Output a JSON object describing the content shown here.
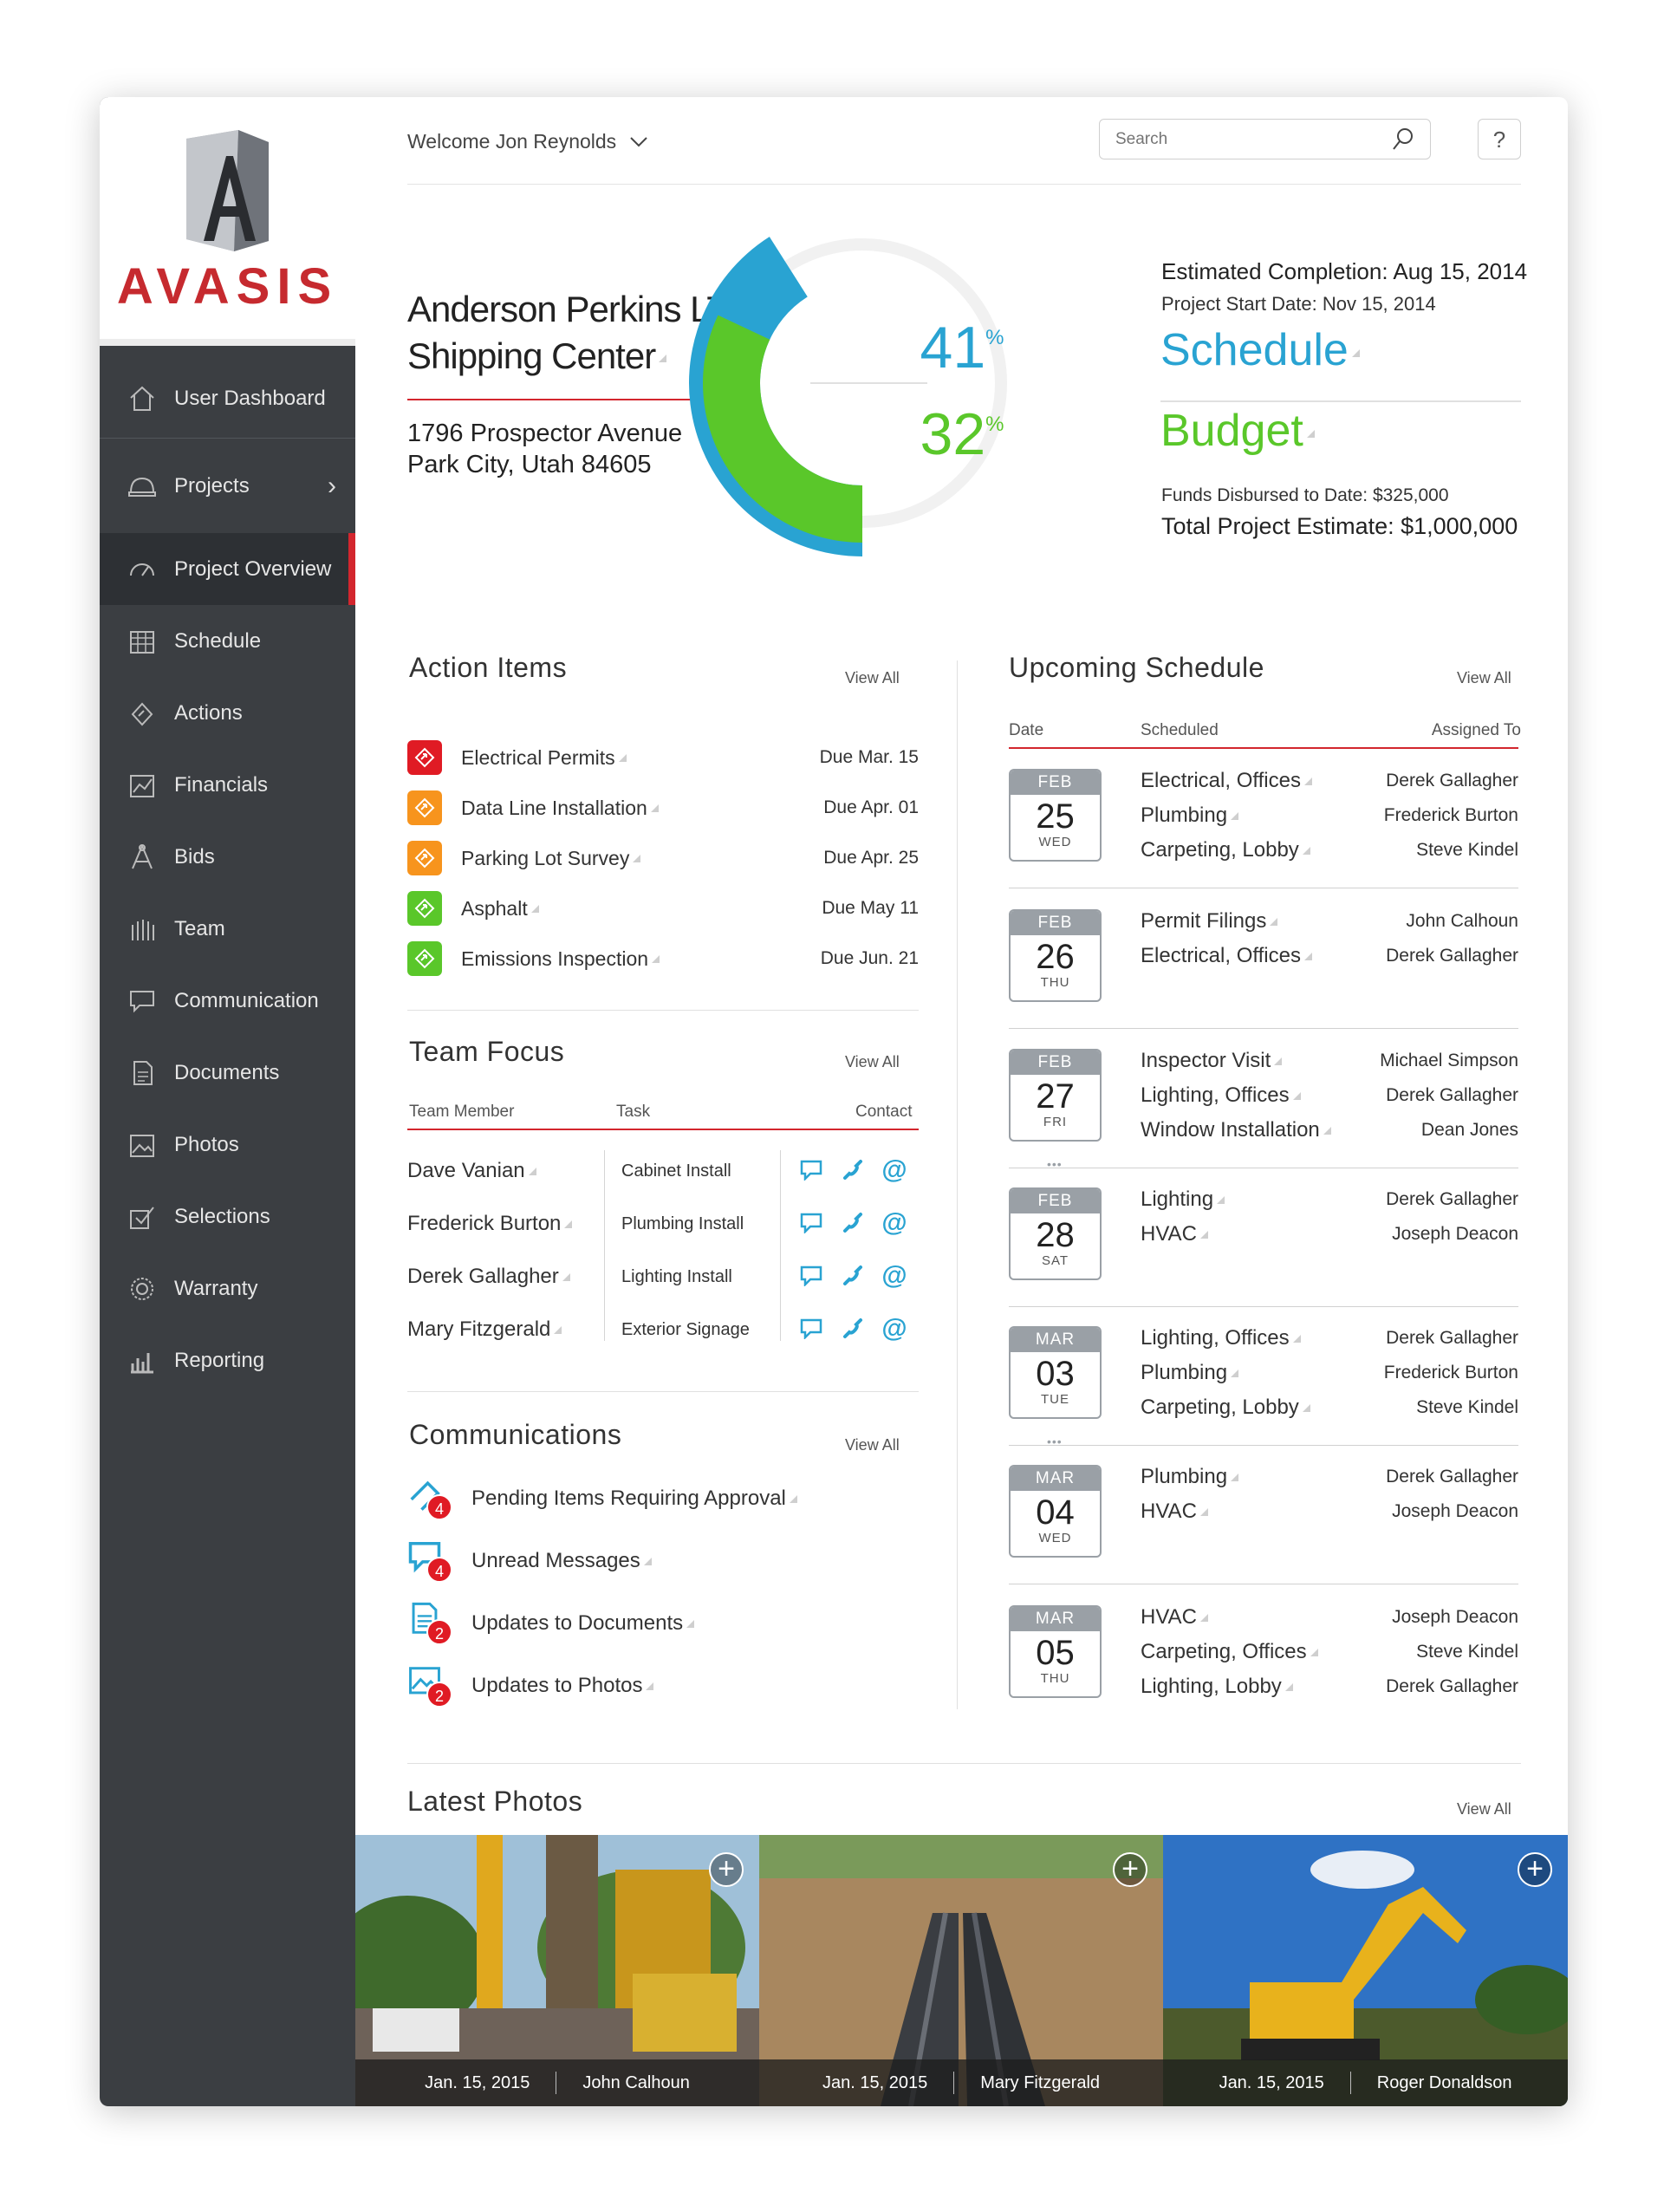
{
  "brand": {
    "name": "AVASIS",
    "tm": "™"
  },
  "header": {
    "welcome": "Welcome Jon Reynolds",
    "search_placeholder": "Search",
    "help": "?"
  },
  "sidebar": {
    "items": [
      {
        "label": "User Dashboard",
        "icon": "home-icon"
      },
      {
        "label": "Projects",
        "icon": "hard-hat-icon"
      },
      {
        "label": "Project Overview",
        "icon": "gauge-icon",
        "active": true
      },
      {
        "label": "Schedule",
        "icon": "calendar-icon"
      },
      {
        "label": "Actions",
        "icon": "action-icon"
      },
      {
        "label": "Financials",
        "icon": "chart-icon"
      },
      {
        "label": "Bids",
        "icon": "compass-icon"
      },
      {
        "label": "Team",
        "icon": "team-icon"
      },
      {
        "label": "Communication",
        "icon": "chat-icon"
      },
      {
        "label": "Documents",
        "icon": "document-icon"
      },
      {
        "label": "Photos",
        "icon": "photo-icon"
      },
      {
        "label": "Selections",
        "icon": "selection-icon"
      },
      {
        "label": "Warranty",
        "icon": "warranty-icon"
      },
      {
        "label": "Reporting",
        "icon": "bar-chart-icon"
      }
    ]
  },
  "project": {
    "name_line1": "Anderson Perkins LTD",
    "name_line2": "Shipping Center",
    "address_line1": "1796 Prospector Avenue",
    "address_line2": "Park City, Utah  84605",
    "schedule_pct": "41",
    "budget_pct": "32",
    "pct_sign": "%",
    "schedule_value": 0.41,
    "budget_value": 0.32,
    "schedule_color": "#29a3d2",
    "budget_color": "#5ac72a",
    "est_completion": "Estimated Completion: Aug 15, 2014",
    "start_date": "Project Start Date: Nov 15, 2014",
    "schedule_label": "Schedule",
    "budget_label": "Budget",
    "funds": "Funds Disbursed to Date: $325,000",
    "total": "Total Project Estimate: $1,000,000"
  },
  "action_items": {
    "title": "Action Items",
    "view_all": "View All",
    "items": [
      {
        "label": "Electrical Permits",
        "due": "Due Mar. 15",
        "color": "#e01b24"
      },
      {
        "label": "Data Line Installation",
        "due": "Due Apr. 01",
        "color": "#f7941d"
      },
      {
        "label": "Parking Lot Survey",
        "due": "Due Apr. 25",
        "color": "#f7941d"
      },
      {
        "label": "Asphalt",
        "due": "Due May 11",
        "color": "#5ac72a"
      },
      {
        "label": "Emissions Inspection",
        "due": "Due Jun. 21",
        "color": "#5ac72a"
      }
    ]
  },
  "team_focus": {
    "title": "Team Focus",
    "view_all": "View All",
    "col_member": "Team Member",
    "col_task": "Task",
    "col_contact": "Contact",
    "rows": [
      {
        "name": "Dave Vanian",
        "task": "Cabinet Install"
      },
      {
        "name": "Frederick Burton",
        "task": "Plumbing Install"
      },
      {
        "name": "Derek Gallagher",
        "task": "Lighting Install"
      },
      {
        "name": "Mary Fitzgerald",
        "task": "Exterior Signage"
      }
    ]
  },
  "communications": {
    "title": "Communications",
    "view_all": "View All",
    "items": [
      {
        "label": "Pending Items Requiring Approval",
        "count": "4",
        "icon": "approval-icon"
      },
      {
        "label": "Unread Messages",
        "count": "4",
        "icon": "message-icon"
      },
      {
        "label": "Updates to Documents",
        "count": "2",
        "icon": "document-icon"
      },
      {
        "label": "Updates to Photos",
        "count": "2",
        "icon": "photo-icon"
      }
    ]
  },
  "schedule": {
    "title": "Upcoming Schedule",
    "view_all": "View All",
    "col_date": "Date",
    "col_scheduled": "Scheduled",
    "col_assigned": "Assigned To",
    "days": [
      {
        "month": "FEB",
        "day": "25",
        "weekday": "WED",
        "tasks": [
          [
            "Electrical, Offices",
            "Derek Gallagher"
          ],
          [
            "Plumbing",
            "Frederick Burton"
          ],
          [
            "Carpeting, Lobby",
            "Steve Kindel"
          ]
        ]
      },
      {
        "month": "FEB",
        "day": "26",
        "weekday": "THU",
        "tasks": [
          [
            "Permit Filings",
            "John Calhoun"
          ],
          [
            "Electrical, Offices",
            "Derek Gallagher"
          ]
        ]
      },
      {
        "month": "FEB",
        "day": "27",
        "weekday": "FRI",
        "tasks": [
          [
            "Inspector Visit",
            "Michael Simpson"
          ],
          [
            "Lighting, Offices",
            "Derek Gallagher"
          ],
          [
            "Window Installation",
            "Dean Jones"
          ]
        ]
      },
      {
        "month": "FEB",
        "day": "28",
        "weekday": "SAT",
        "tasks": [
          [
            "Lighting",
            "Derek Gallagher"
          ],
          [
            "HVAC",
            "Joseph Deacon"
          ]
        ]
      },
      {
        "month": "MAR",
        "day": "03",
        "weekday": "TUE",
        "tasks": [
          [
            "Lighting, Offices",
            "Derek Gallagher"
          ],
          [
            "Plumbing",
            "Frederick Burton"
          ],
          [
            "Carpeting, Lobby",
            "Steve Kindel"
          ]
        ]
      },
      {
        "month": "MAR",
        "day": "04",
        "weekday": "WED",
        "tasks": [
          [
            "Plumbing",
            "Derek Gallagher"
          ],
          [
            "HVAC",
            "Joseph Deacon"
          ]
        ]
      },
      {
        "month": "MAR",
        "day": "05",
        "weekday": "THU",
        "tasks": [
          [
            "HVAC",
            "Joseph Deacon"
          ],
          [
            "Carpeting, Offices",
            "Steve Kindel"
          ],
          [
            "Lighting, Lobby",
            "Derek Gallagher"
          ]
        ]
      }
    ]
  },
  "photos": {
    "title": "Latest Photos",
    "view_all": "View All",
    "items": [
      {
        "date": "Jan. 15, 2015",
        "author": "John Calhoun"
      },
      {
        "date": "Jan. 15, 2015",
        "author": "Mary Fitzgerald"
      },
      {
        "date": "Jan. 15, 2015",
        "author": "Roger Donaldson"
      }
    ]
  }
}
